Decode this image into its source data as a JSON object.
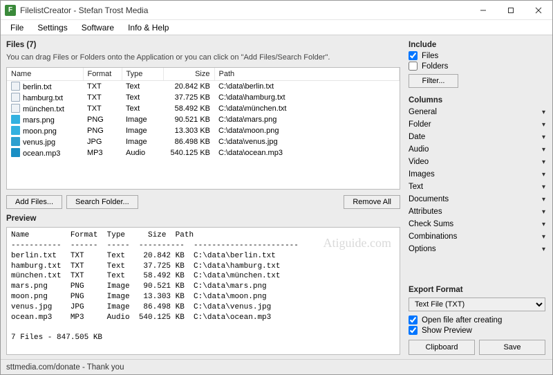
{
  "window": {
    "title": "FilelistCreator - Stefan Trost Media"
  },
  "menu": {
    "file": "File",
    "settings": "Settings",
    "software": "Software",
    "info": "Info & Help"
  },
  "files_section": {
    "header": "Files (7)",
    "hint": "You can drag Files or Folders onto the Application or you can click on \"Add Files/Search Folder\".",
    "columns": {
      "name": "Name",
      "format": "Format",
      "type": "Type",
      "size": "Size",
      "path": "Path"
    },
    "rows": [
      {
        "icon": "txt",
        "name": "berlin.txt",
        "format": "TXT",
        "type": "Text",
        "size": "20.842 KB",
        "path": "C:\\data\\berlin.txt"
      },
      {
        "icon": "txt",
        "name": "hamburg.txt",
        "format": "TXT",
        "type": "Text",
        "size": "37.725 KB",
        "path": "C:\\data\\hamburg.txt"
      },
      {
        "icon": "txt",
        "name": "münchen.txt",
        "format": "TXT",
        "type": "Text",
        "size": "58.492 KB",
        "path": "C:\\data\\münchen.txt"
      },
      {
        "icon": "png",
        "name": "mars.png",
        "format": "PNG",
        "type": "Image",
        "size": "90.521 KB",
        "path": "C:\\data\\mars.png"
      },
      {
        "icon": "png",
        "name": "moon.png",
        "format": "PNG",
        "type": "Image",
        "size": "13.303 KB",
        "path": "C:\\data\\moon.png"
      },
      {
        "icon": "jpg",
        "name": "venus.jpg",
        "format": "JPG",
        "type": "Image",
        "size": "86.498 KB",
        "path": "C:\\data\\venus.jpg"
      },
      {
        "icon": "mp3",
        "name": "ocean.mp3",
        "format": "MP3",
        "type": "Audio",
        "size": "540.125 KB",
        "path": "C:\\data\\ocean.mp3"
      }
    ],
    "add_files": "Add Files...",
    "search_folder": "Search Folder...",
    "remove_all": "Remove All"
  },
  "preview": {
    "header": "Preview",
    "text": "Name         Format  Type     Size  Path\n-----------  ------  -----  ----------  -----------------------\nberlin.txt   TXT     Text    20.842 KB  C:\\data\\berlin.txt\nhamburg.txt  TXT     Text    37.725 KB  C:\\data\\hamburg.txt\nmünchen.txt  TXT     Text    58.492 KB  C:\\data\\münchen.txt\nmars.png     PNG     Image   90.521 KB  C:\\data\\mars.png\nmoon.png     PNG     Image   13.303 KB  C:\\data\\moon.png\nvenus.jpg    JPG     Image   86.498 KB  C:\\data\\venus.jpg\nocean.mp3    MP3     Audio  540.125 KB  C:\\data\\ocean.mp3\n\n7 Files - 847.505 KB",
    "watermark": "Atiguide.com"
  },
  "include": {
    "header": "Include",
    "files_label": "Files",
    "files_checked": true,
    "folders_label": "Folders",
    "folders_checked": false,
    "filter": "Filter..."
  },
  "columns": {
    "header": "Columns",
    "items": [
      "General",
      "Folder",
      "Date",
      "Audio",
      "Video",
      "Images",
      "Text",
      "Documents",
      "Attributes",
      "Check Sums",
      "Combinations",
      "Options"
    ]
  },
  "export": {
    "header": "Export Format",
    "selected": "Text File (TXT)",
    "open_after_label": "Open file after creating",
    "open_after_checked": true,
    "show_preview_label": "Show Preview",
    "show_preview_checked": true,
    "clipboard": "Clipboard",
    "save": "Save"
  },
  "status": "sttmedia.com/donate - Thank you"
}
